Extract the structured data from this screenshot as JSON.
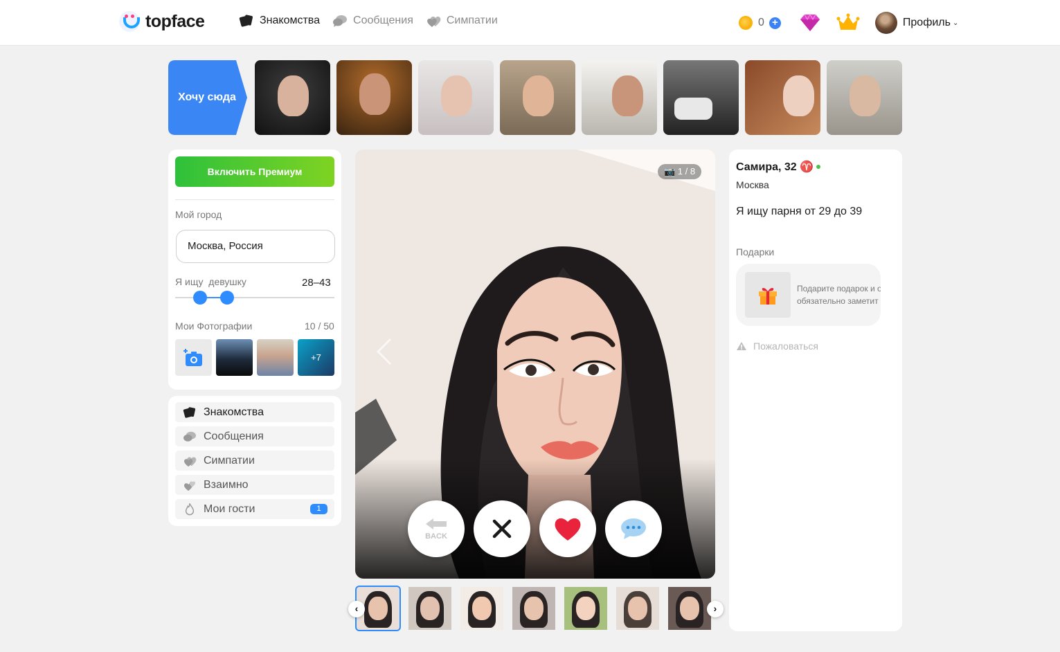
{
  "header": {
    "logo_text": "topface",
    "nav": [
      {
        "label": "Знакомства",
        "active": true
      },
      {
        "label": "Сообщения",
        "active": false
      },
      {
        "label": "Симпатии",
        "active": false
      }
    ],
    "coins": "0",
    "coin_plus": "+",
    "profile_label": "Профиль"
  },
  "stories": {
    "want_label": "Хочу сюда"
  },
  "left": {
    "premium_button": "Включить Премиум",
    "city_label": "Мой город",
    "city_value": "Москва, Россия",
    "seek_label": "Я ищу  девушку",
    "age_range": "28–43",
    "age_min": 28,
    "age_max": 43,
    "photos_label": "Мои Фотографии",
    "photos_count": "10 / 50",
    "more_photos": "+7",
    "nav": [
      {
        "label": "Знакомства",
        "active": true
      },
      {
        "label": "Сообщения",
        "active": false
      },
      {
        "label": "Симпатии",
        "active": false
      },
      {
        "label": "Взаимно",
        "active": false
      },
      {
        "label": "Мои гости",
        "active": false,
        "badge": "1"
      }
    ]
  },
  "main": {
    "photo_counter": "1 / 8",
    "back_label": "BACK"
  },
  "profile": {
    "name": "Самира, 32",
    "zodiac": "♈",
    "city": "Москва",
    "seek": "Я ищу парня от 29 до 39",
    "gifts_label": "Подарки",
    "gift_text_1": "Подарите подарок и она",
    "gift_text_2": "обязательно заметит вас",
    "report": "Пожаловаться"
  },
  "colors": {
    "accent": "#2f8cff",
    "premium_green": "#2ec13b",
    "like_red": "#e8233b"
  }
}
